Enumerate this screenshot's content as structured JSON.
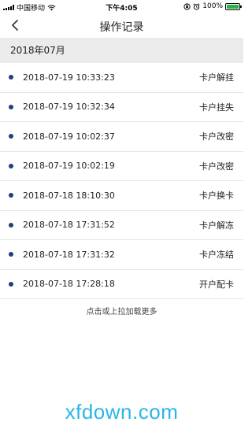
{
  "status_bar": {
    "carrier": "中国移动",
    "time": "下午4:05",
    "battery_percent": "100%",
    "battery_level": 1.0
  },
  "nav": {
    "title": "操作记录",
    "back_icon": "chevron-left-icon"
  },
  "section": {
    "label": "2018年07月"
  },
  "records": [
    {
      "time": "2018-07-19 10:33:23",
      "action": "卡户解挂"
    },
    {
      "time": "2018-07-19 10:32:34",
      "action": "卡户挂失"
    },
    {
      "time": "2018-07-19 10:02:37",
      "action": "卡户改密"
    },
    {
      "time": "2018-07-19 10:02:19",
      "action": "卡户改密"
    },
    {
      "time": "2018-07-18 18:10:30",
      "action": "卡户换卡"
    },
    {
      "time": "2018-07-18 17:31:52",
      "action": "卡户解冻"
    },
    {
      "time": "2018-07-18 17:31:32",
      "action": "卡户冻结"
    },
    {
      "time": "2018-07-18 17:28:18",
      "action": "开户配卡"
    }
  ],
  "load_more": "点击或上拉加载更多",
  "watermark": "xfdown.com",
  "colors": {
    "dot": "#1d3f7a",
    "section_bg": "#ebebeb",
    "watermark": "#2bb5e8",
    "battery": "#26b14a"
  }
}
